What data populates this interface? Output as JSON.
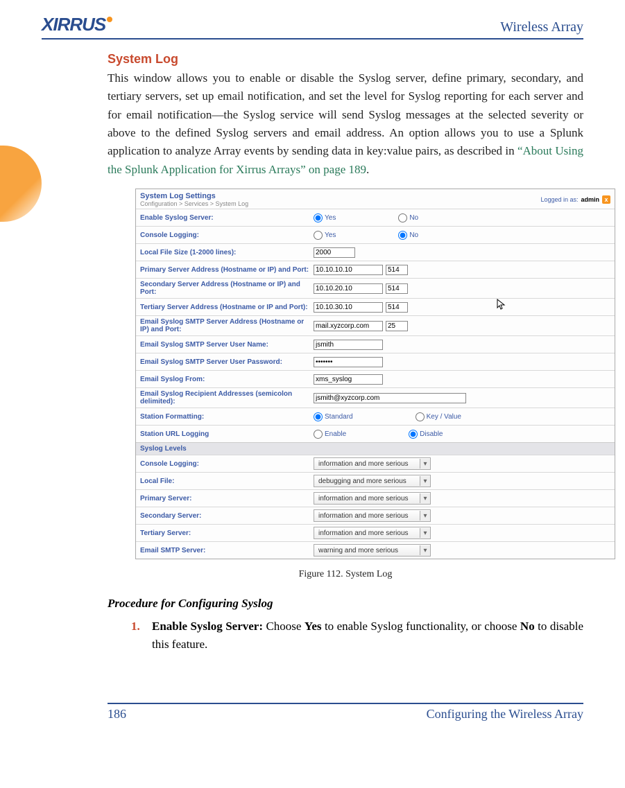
{
  "header": {
    "logo_text": "XIRRUS",
    "right": "Wireless Array"
  },
  "section_title": "System Log",
  "paragraph": {
    "p1a": "This window allows you to enable or disable the Syslog server, define primary, secondary, and tertiary servers, set up email notification, and set the level for Syslog reporting for each server and for email notification—the Syslog service will send Syslog messages at the selected severity or above to the defined Syslog servers and email address. An option allows you to use a Splunk application to analyze Array events by sending data in key:value pairs, as described in ",
    "link": "“About Using the Splunk Application for Xirrus Arrays” on page 189",
    "p1b": "."
  },
  "screenshot": {
    "title": "System Log Settings",
    "breadcrumb": "Configuration > Services > System Log",
    "login_prefix": "Logged in as: ",
    "login_user": "admin",
    "rows": {
      "enable_syslog": {
        "label": "Enable Syslog Server:",
        "yes": "Yes",
        "no": "No"
      },
      "console_logging": {
        "label": "Console Logging:",
        "yes": "Yes",
        "no": "No"
      },
      "local_file": {
        "label": "Local File Size (1-2000 lines):",
        "value": "2000"
      },
      "primary": {
        "label": "Primary Server Address (Hostname or IP) and Port:",
        "host": "10.10.10.10",
        "port": "514"
      },
      "secondary": {
        "label": "Secondary Server Address (Hostname or IP) and Port:",
        "host": "10.10.20.10",
        "port": "514"
      },
      "tertiary": {
        "label": "Tertiary Server Address (Hostname or IP and Port):",
        "host": "10.10.30.10",
        "port": "514"
      },
      "smtp": {
        "label": "Email Syslog SMTP Server Address (Hostname or IP) and Port:",
        "host": "mail.xyzcorp.com",
        "port": "25"
      },
      "smtp_user": {
        "label": "Email Syslog SMTP Server User Name:",
        "value": "jsmith"
      },
      "smtp_pass": {
        "label": "Email Syslog SMTP Server User Password:",
        "value": "•••••••"
      },
      "from": {
        "label": "Email Syslog From:",
        "value": "xms_syslog"
      },
      "recipients": {
        "label": "Email Syslog Recipient Addresses (semicolon delimited):",
        "value": "jsmith@xyzcorp.com"
      },
      "station_fmt": {
        "label": "Station Formatting:",
        "opt1": "Standard",
        "opt2": "Key / Value"
      },
      "station_url": {
        "label": "Station URL Logging",
        "opt1": "Enable",
        "opt2": "Disable"
      }
    },
    "levels_header": "Syslog Levels",
    "levels": {
      "console": {
        "label": "Console Logging:",
        "value": "information and more serious"
      },
      "local": {
        "label": "Local File:",
        "value": "debugging and more serious"
      },
      "primary": {
        "label": "Primary Server:",
        "value": "information and more serious"
      },
      "secondary": {
        "label": "Secondary Server:",
        "value": "information and more serious"
      },
      "tertiary": {
        "label": "Tertiary Server:",
        "value": "information and more serious"
      },
      "email": {
        "label": "Email SMTP Server:",
        "value": "warning and more serious"
      }
    }
  },
  "figure_caption": "Figure 112. System Log",
  "procedure_title": "Procedure for Configuring Syslog",
  "step1": {
    "num": "1.",
    "bold1": "Enable Syslog Server:",
    "text1": " Choose ",
    "bold2": "Yes",
    "text2": " to enable Syslog functionality, or choose ",
    "bold3": "No",
    "text3": " to disable this feature."
  },
  "footer": {
    "page": "186",
    "title": "Configuring the Wireless Array"
  }
}
